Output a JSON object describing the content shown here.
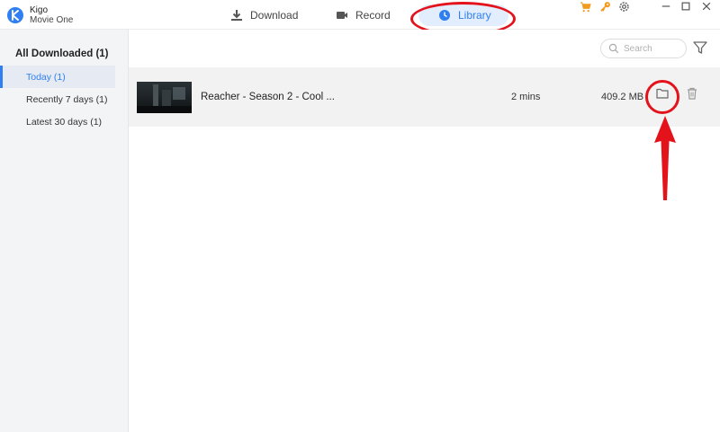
{
  "app": {
    "name": "Kigo",
    "subtitle": "Movie One",
    "logo_color": "#2f7ff2"
  },
  "nav": {
    "tabs": [
      {
        "label": "Download",
        "icon": "download-icon",
        "active": false
      },
      {
        "label": "Record",
        "icon": "video-camera-icon",
        "active": false
      },
      {
        "label": "Library",
        "icon": "clock-icon",
        "active": true
      }
    ],
    "accent": "#2f7ff2"
  },
  "window_controls": {
    "icons": [
      "cart-icon",
      "key-icon",
      "gear-icon",
      "minimize-icon",
      "maximize-icon",
      "close-icon"
    ],
    "highlight_color": "#f39a1c"
  },
  "sidebar": {
    "heading": "All Downloaded (1)",
    "items": [
      {
        "label": "Today (1)",
        "active": true
      },
      {
        "label": "Recently 7 days (1)",
        "active": false
      },
      {
        "label": "Latest 30 days (1)",
        "active": false
      }
    ]
  },
  "search": {
    "placeholder": "Search"
  },
  "library": {
    "rows": [
      {
        "title": "Reacher - Season 2 - Cool ...",
        "duration": "2 mins",
        "size": "409.2 MB"
      }
    ]
  },
  "annotation_color": "#e3121b"
}
